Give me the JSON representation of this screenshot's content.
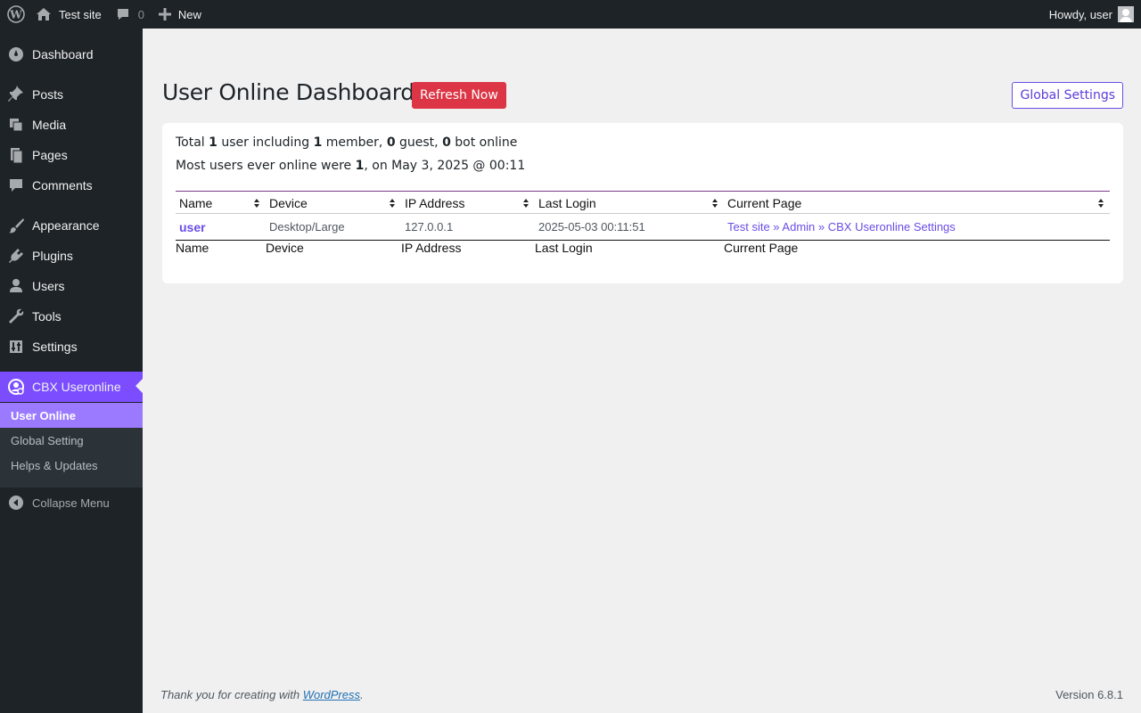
{
  "adminbar": {
    "site_name": "Test site",
    "comments_count": "0",
    "new_label": "New",
    "howdy": "Howdy, user"
  },
  "sidebar": {
    "items": [
      {
        "label": "Dashboard",
        "icon": "dashboard-icon"
      },
      {
        "label": "Posts",
        "icon": "pin-icon"
      },
      {
        "label": "Media",
        "icon": "media-icon"
      },
      {
        "label": "Pages",
        "icon": "pages-icon"
      },
      {
        "label": "Comments",
        "icon": "comment-icon"
      },
      {
        "label": "Appearance",
        "icon": "brush-icon"
      },
      {
        "label": "Plugins",
        "icon": "plugin-icon"
      },
      {
        "label": "Users",
        "icon": "user-icon"
      },
      {
        "label": "Tools",
        "icon": "wrench-icon"
      },
      {
        "label": "Settings",
        "icon": "settings-icon"
      },
      {
        "label": "CBX Useronline",
        "icon": "useronline-icon"
      }
    ],
    "submenu": [
      {
        "label": "User Online"
      },
      {
        "label": "Global Setting"
      },
      {
        "label": "Helps & Updates"
      }
    ],
    "collapse_label": "Collapse Menu"
  },
  "main": {
    "title": "User Online Dashboard",
    "refresh_label": "Refresh Now",
    "global_settings_label": "Global Settings",
    "summary": {
      "total_prefix": "Total ",
      "total": "1",
      "user_including": " user including ",
      "members": "1",
      "member_text": " member, ",
      "guests": "0",
      "guest_text": " guest, ",
      "bots": "0",
      "bot_text": " bot online",
      "most_prefix": "Most users ever online were ",
      "most_count": "1",
      "most_suffix": ", on May 3, 2025 @ 00:11"
    },
    "table": {
      "headers": [
        "Name",
        "Device",
        "IP Address",
        "Last Login",
        "Current Page"
      ],
      "rows": [
        {
          "name": "user",
          "device": "Desktop/Large",
          "ip": "127.0.0.1",
          "last_login": "2025-05-03 00:11:51",
          "current_page": "Test site » Admin » CBX Useronline Settings"
        }
      ]
    }
  },
  "footer": {
    "thanks_prefix": "Thank you for creating with ",
    "wp_link": "WordPress",
    "thanks_suffix": ".",
    "version": "Version 6.8.1"
  },
  "colors": {
    "accent": "#7c4dff",
    "accent_light": "#9b7aff",
    "refresh": "#dc3545",
    "adminbar": "#1d2327"
  }
}
